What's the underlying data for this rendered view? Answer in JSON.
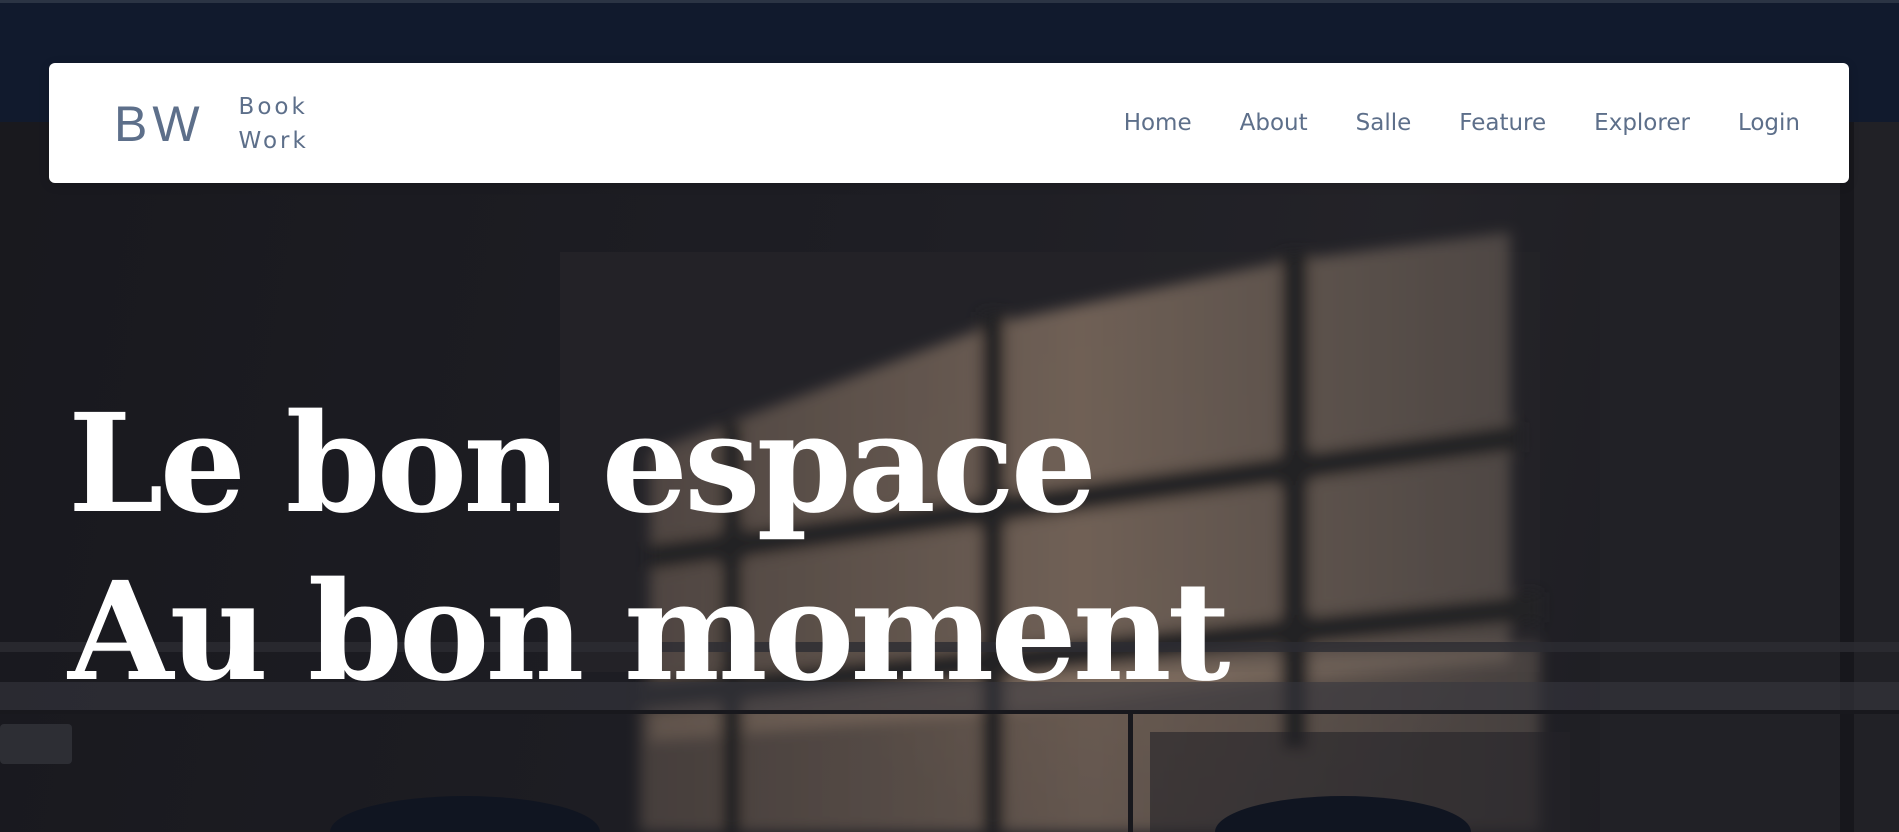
{
  "brand": {
    "mark": "BW",
    "name_line1": "Book",
    "name_line2": "Work"
  },
  "nav": {
    "items": [
      {
        "label": "Home"
      },
      {
        "label": "About"
      },
      {
        "label": "Salle"
      },
      {
        "label": "Feature"
      },
      {
        "label": "Explorer"
      },
      {
        "label": "Login"
      }
    ]
  },
  "hero": {
    "headline_line1": "Le bon espace",
    "headline_line2": "Au bon moment"
  },
  "colors": {
    "header_band": "#111a2d",
    "navbar_bg": "#ffffff",
    "nav_text": "#5d6f8a",
    "headline_text": "#ffffff"
  }
}
